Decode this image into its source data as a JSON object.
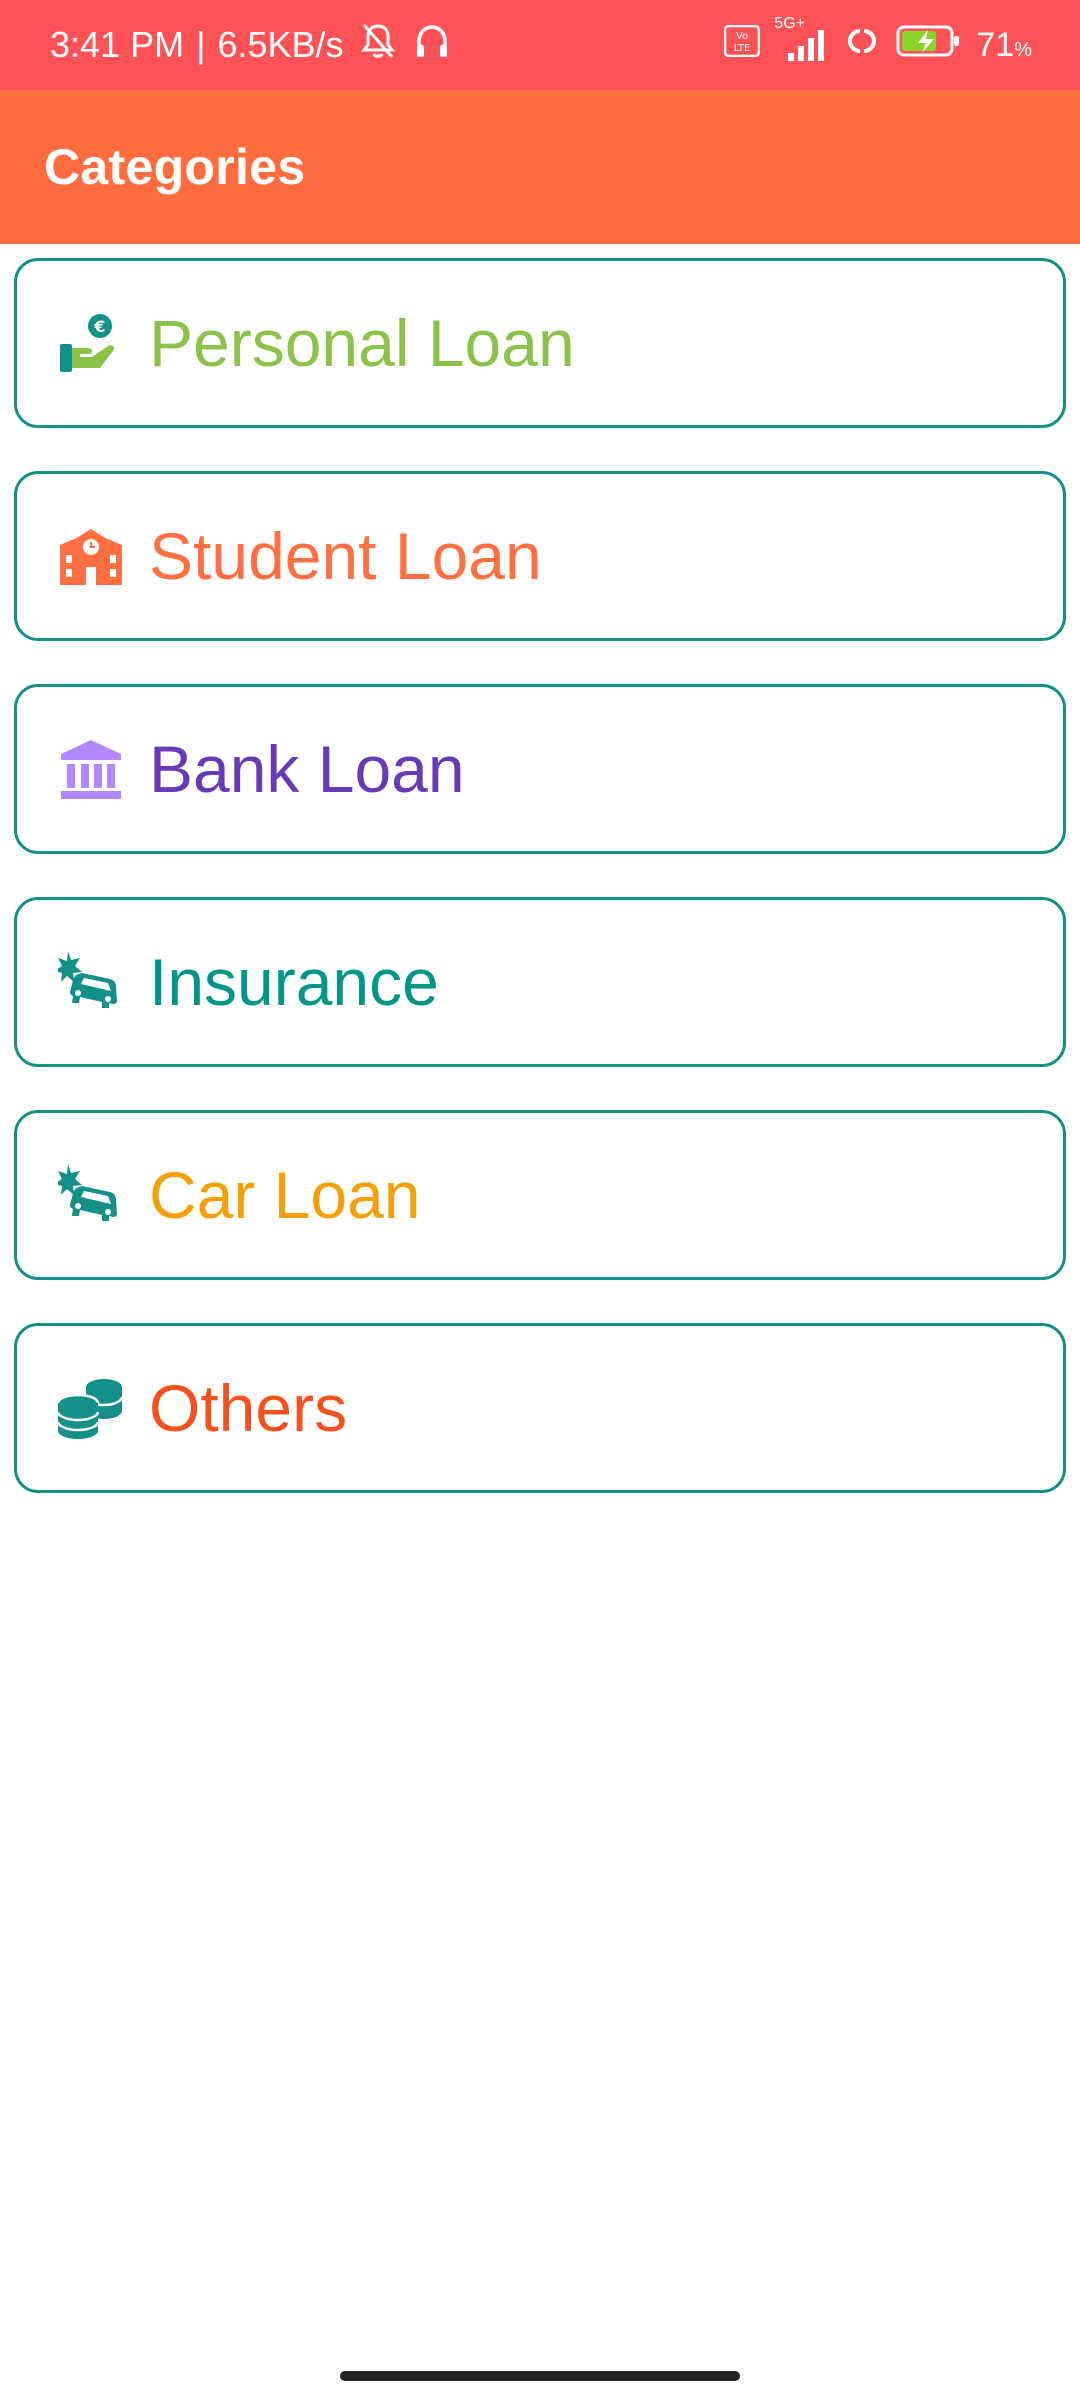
{
  "status_bar": {
    "time": "3:41 PM",
    "separator": "|",
    "speed": "6.5KB/s",
    "network": "5G+",
    "volte": "Vo LTE",
    "battery_percent": "71",
    "battery_unit": "%",
    "icons": [
      "silent-bell-icon",
      "headphones-icon",
      "volte-icon",
      "signal-icon",
      "link-icon",
      "battery-charging-icon"
    ]
  },
  "app_bar": {
    "title": "Categories"
  },
  "categories": [
    {
      "label": "Personal Loan",
      "icon": "hand-coin-icon",
      "color": "#8bc34a"
    },
    {
      "label": "Student Loan",
      "icon": "school-icon",
      "color": "#ff6f42"
    },
    {
      "label": "Bank Loan",
      "icon": "bank-icon",
      "color": "#673ab7"
    },
    {
      "label": "Insurance",
      "icon": "car-crash-icon",
      "color": "#009688"
    },
    {
      "label": "Car Loan",
      "icon": "car-crash-icon",
      "color": "#f5a00a"
    },
    {
      "label": "Others",
      "icon": "coins-icon",
      "color": "#f4511e"
    }
  ],
  "colors": {
    "status_bar": "#ff5256",
    "app_bar": "#ff6c3e",
    "card_border": "#14908a"
  }
}
